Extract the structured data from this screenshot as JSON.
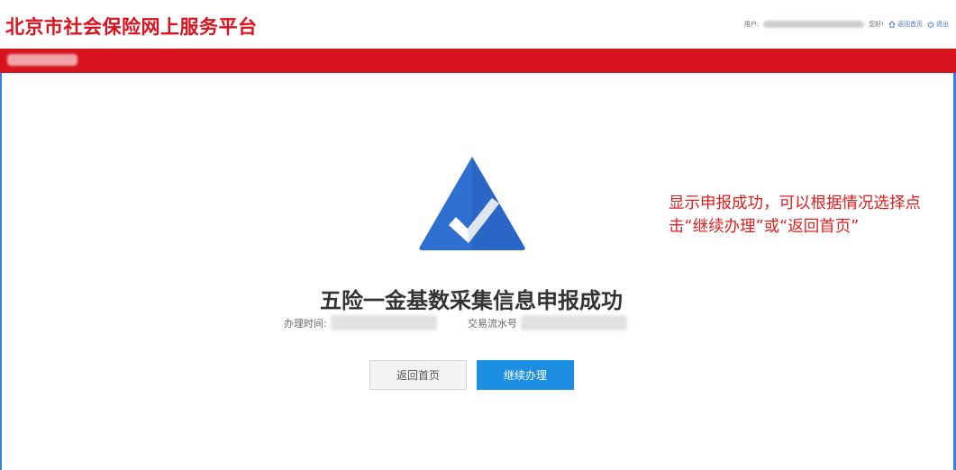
{
  "header": {
    "site_title": "北京市社会保险网上服务平台",
    "user_prefix": "用户:",
    "greeting": "您好!",
    "home_link": "返回首页",
    "logout_link": "退出"
  },
  "success": {
    "title": "五险一金基数采集信息申报成功",
    "time_label": "办理时间:",
    "serial_label": "交易流水号"
  },
  "buttons": {
    "home": "返回首页",
    "continue": "继续办理"
  },
  "annotation": {
    "text": "显示申报成功，可以根据情况选择点击“继续办理”或“返回首页”"
  },
  "colors": {
    "brand_red": "#d7131e",
    "button_blue": "#1d8fe3",
    "logo_blue": "#2f6fd0",
    "annotation_red": "#e02020"
  }
}
